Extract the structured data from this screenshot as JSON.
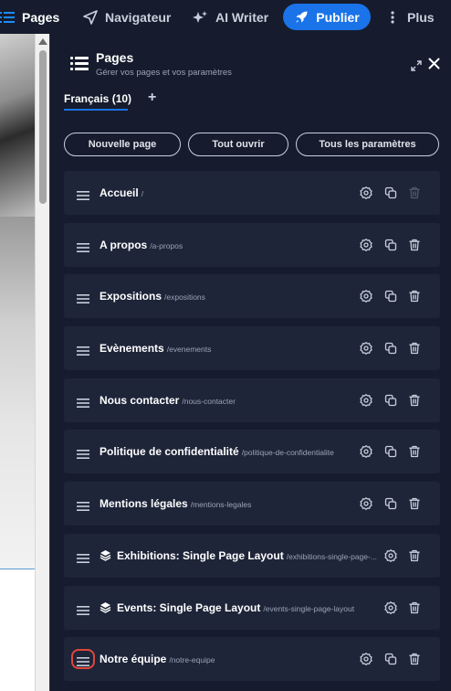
{
  "topbar": {
    "pages": "Pages",
    "navigator": "Navigateur",
    "ai_writer": "AI Writer",
    "publish": "Publier",
    "more": "Plus"
  },
  "panel": {
    "title": "Pages",
    "subtitle": "Gérer vos pages et vos paramètres",
    "language_tab": "Français (10)",
    "add_language": "+",
    "buttons": {
      "new_page": "Nouvelle page",
      "open_all": "Tout ouvrir",
      "all_settings": "Tous les paramètres"
    }
  },
  "pages": [
    {
      "title": "Accueil",
      "slug": "/",
      "delete_disabled": true
    },
    {
      "title": "A propos",
      "slug": "/a-propos"
    },
    {
      "title": "Expositions",
      "slug": "/expositions"
    },
    {
      "title": "Evènements",
      "slug": "/evenements"
    },
    {
      "title": "Nous contacter",
      "slug": "/nous-contacter"
    },
    {
      "title": "Politique de confidentialité",
      "slug": "/politique-de-confidentialite"
    },
    {
      "title": "Mentions légales",
      "slug": "/mentions-legales"
    },
    {
      "title": "Exhibitions: Single Page Layout",
      "slug": "/exhibitions-single-page-...",
      "collection": true
    },
    {
      "title": "Events: Single Page Layout",
      "slug": "/events-single-page-layout",
      "collection": true
    },
    {
      "title": "Notre équipe",
      "slug": "/notre-equipe",
      "highlighted": true
    }
  ],
  "colors": {
    "background": "#161c2d",
    "row": "#1e2539",
    "accent": "#1a73e8",
    "highlight": "#e0463a"
  }
}
